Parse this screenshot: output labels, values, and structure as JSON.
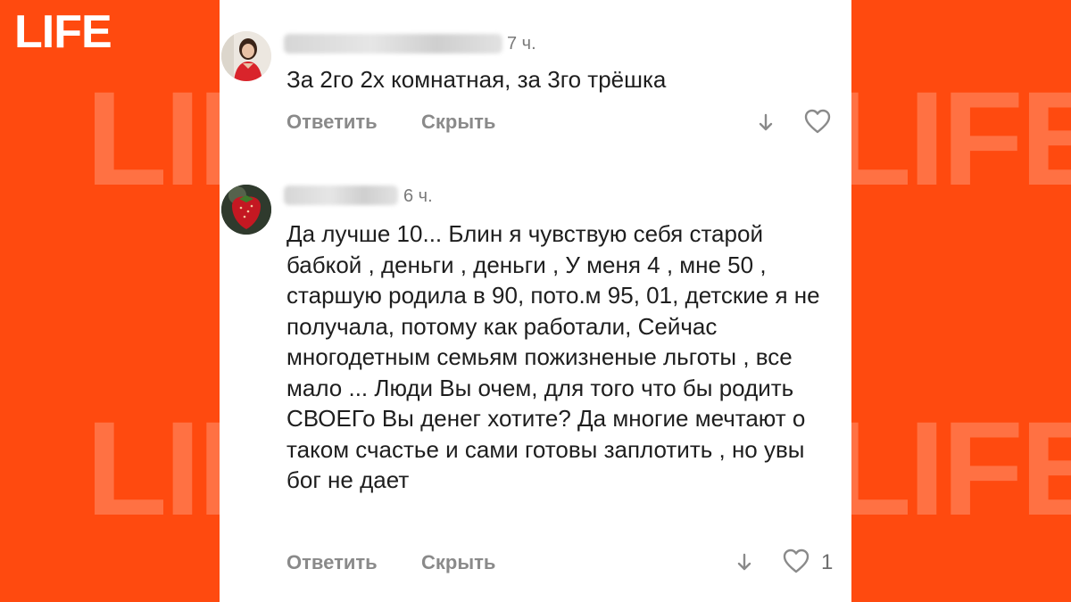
{
  "brand": {
    "logo": "LIFE",
    "watermark": "LIFE"
  },
  "comments": [
    {
      "time": "7 ч.",
      "text": "За 2го 2х комнатная, за 3го трёшка",
      "reply_label": "Ответить",
      "hide_label": "Скрыть",
      "likes": ""
    },
    {
      "time": "6 ч.",
      "text": "Да лучше 10... Блин я чувствую себя старой бабкой , деньги , деньги , У меня 4 , мне 50 , старшую родила в 90, пото.м 95, 01, детские я не получала, потому как работали, Сейчас многодетным семьям пожизненые льготы , все мало ... Люди Вы очем, для того что бы родить СВОЕГо Вы денег хотите? Да многие мечтают о таком счастье и сами готовы заплотить , но увы бог не дает",
      "reply_label": "Ответить",
      "hide_label": "Скрыть",
      "likes": "1"
    }
  ],
  "colors": {
    "brand_bg": "#ff4a0f",
    "panel_bg": "#ffffff",
    "text": "#1e1e1e",
    "muted": "#8a8a8a"
  },
  "icons": [
    "down-arrow-icon",
    "heart-icon"
  ]
}
